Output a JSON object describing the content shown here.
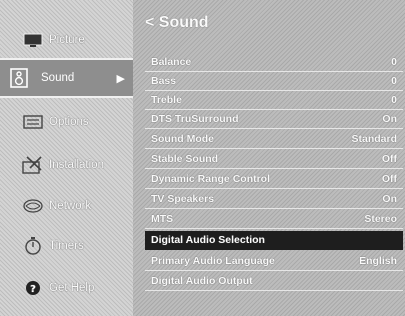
{
  "sidebar": {
    "items": [
      {
        "label": "Picture",
        "icon": "picture-icon"
      },
      {
        "label": "Sound",
        "icon": "speaker-icon"
      },
      {
        "label": "Options",
        "icon": "options-icon"
      },
      {
        "label": "Installation",
        "icon": "installation-icon"
      },
      {
        "label": "Network",
        "icon": "network-icon"
      },
      {
        "label": "Timers",
        "icon": "timer-icon"
      },
      {
        "label": "Get Help",
        "icon": "help-icon"
      }
    ],
    "active_index": 1,
    "active_arrow": "▶"
  },
  "main": {
    "title": "< Sound",
    "rows": [
      {
        "label": "Balance",
        "value": "0"
      },
      {
        "label": "Bass",
        "value": "0"
      },
      {
        "label": "Treble",
        "value": "0"
      },
      {
        "label": "DTS TruSurround",
        "value": "On"
      },
      {
        "label": "Sound Mode",
        "value": "Standard"
      },
      {
        "label": "Stable Sound",
        "value": "Off"
      },
      {
        "label": "Dynamic Range Control",
        "value": "Off"
      },
      {
        "label": "TV Speakers",
        "value": "On"
      },
      {
        "label": "MTS",
        "value": "Stereo"
      },
      {
        "label": "Digital Audio Selection",
        "value": ""
      },
      {
        "label": "Primary Audio Language",
        "value": "English"
      },
      {
        "label": "Digital Audio Output",
        "value": ""
      }
    ],
    "selected_index": 9
  }
}
